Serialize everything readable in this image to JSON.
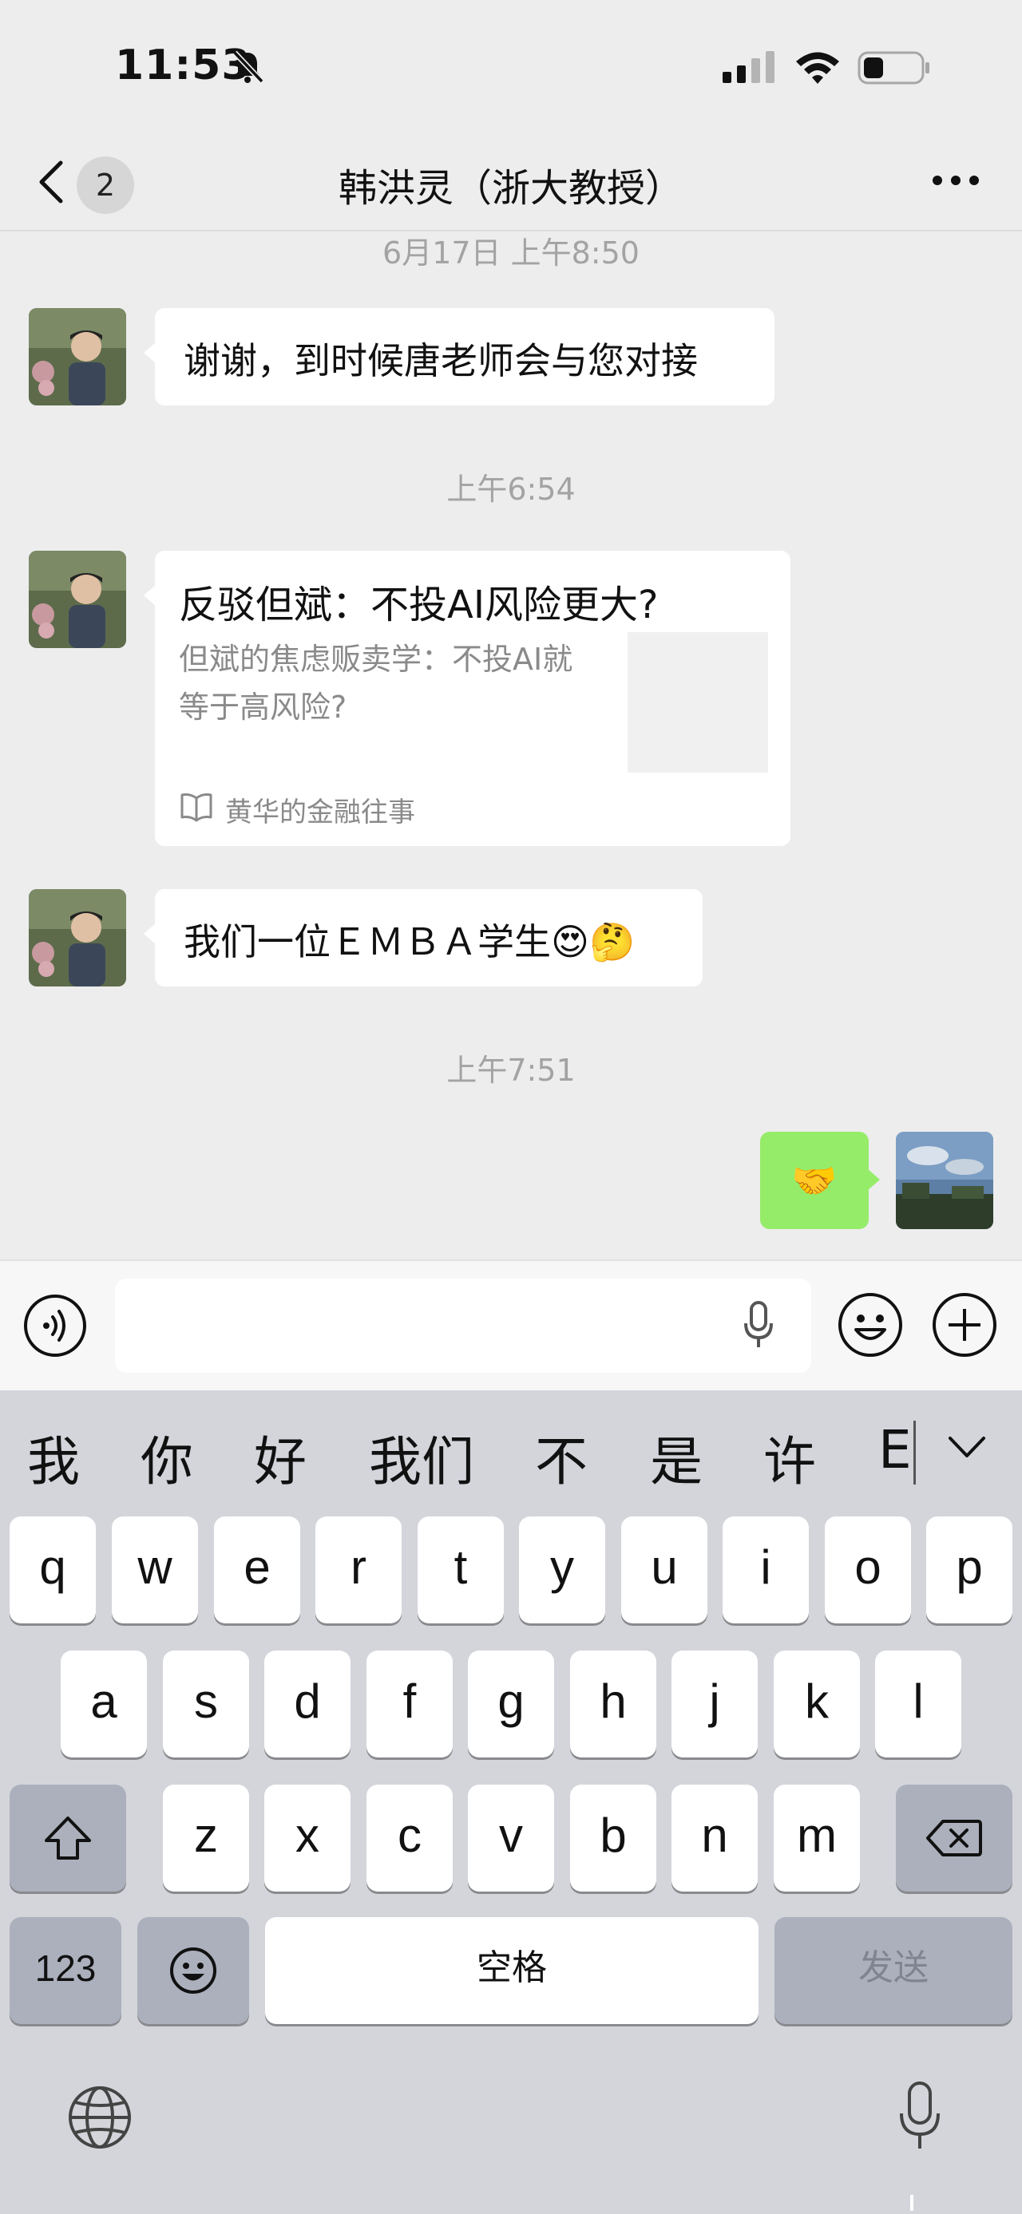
{
  "status_bar": {
    "time": "11:53"
  },
  "nav": {
    "unread_count": "2",
    "title": "韩洪灵（浙大教授）"
  },
  "messages": {
    "ts1": "6月17日 上午8:50",
    "msg1": "谢谢，到时候唐老师会与您对接",
    "ts2": "上午6:54",
    "card": {
      "title": "反驳但斌：不投AI风险更大?",
      "description": "但斌的焦虑贩卖学：不投AI就等于高风险?",
      "source": "黄华的金融往事"
    },
    "msg3": "我们一位ＥＭＢＡ学生",
    "msg3_emoji": "😍🤔",
    "ts3": "上午7:51",
    "my_msg": "🤝"
  },
  "input": {
    "placeholder": ""
  },
  "keyboard": {
    "candidates": [
      "我",
      "你",
      "好",
      "我们",
      "不",
      "是",
      "许",
      "E"
    ],
    "row1": [
      "q",
      "w",
      "e",
      "r",
      "t",
      "y",
      "u",
      "i",
      "o",
      "p"
    ],
    "row2": [
      "a",
      "s",
      "d",
      "f",
      "g",
      "h",
      "j",
      "k",
      "l"
    ],
    "row3": [
      "z",
      "x",
      "c",
      "v",
      "b",
      "n",
      "m"
    ],
    "num_label": "123",
    "space_label": "空格",
    "send_label": "发送"
  },
  "colors": {
    "my_bubble": "#95ec69",
    "background": "#ededed",
    "keyboard": "#d3d5db"
  },
  "icons": [
    "bell-slash-icon",
    "signal-icon",
    "wifi-icon",
    "battery-icon",
    "back-chevron-icon",
    "more-icon",
    "voice-icon",
    "mic-icon",
    "emoji-icon",
    "plus-icon",
    "globe-icon",
    "dictation-icon",
    "shift-icon",
    "delete-icon"
  ]
}
